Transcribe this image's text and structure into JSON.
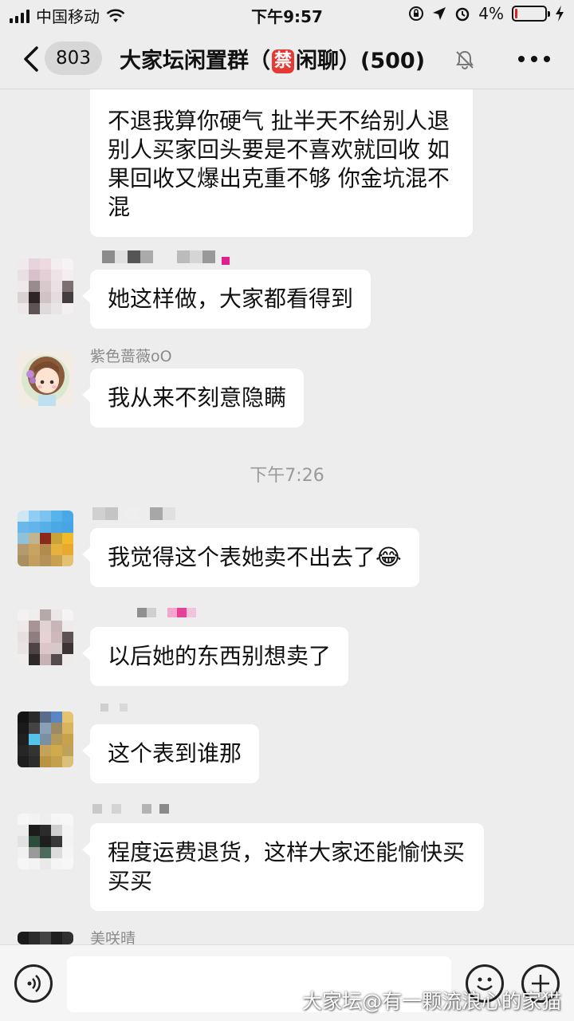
{
  "status_bar": {
    "carrier": "中国移动",
    "time": "下午9:57",
    "battery": "4%"
  },
  "nav": {
    "unread_count": "803",
    "title_prefix": "大家坛闲置群（",
    "ban_char": "禁",
    "title_suffix": "闲聊）(500)"
  },
  "messages": [
    {
      "sender": "",
      "text": "不退我算你硬气 扯半天不给别人退 别人买家回头要是不喜欢就回收 如果回收又爆出克重不够 你金坑混不混"
    },
    {
      "sender": "",
      "text": "她这样做，大家都看得到"
    },
    {
      "sender": "紫色蔷薇oO",
      "text": "我从来不刻意隐瞒"
    },
    {
      "sender": "",
      "text": "我觉得这个表她卖不出去了",
      "emoji": "😂"
    },
    {
      "sender": "",
      "text": "以后她的东西别想卖了"
    },
    {
      "sender": "",
      "text": "这个表到谁那"
    },
    {
      "sender": "",
      "text": "程度运费退货，这样大家还能愉快买买买"
    },
    {
      "sender": "美咲晴",
      "text": ""
    }
  ],
  "time_separator": "下午7:26",
  "watermark": "大家坛@有一颗流浪心的家猫",
  "colors": {
    "background": "#ededed",
    "bubble": "#ffffff",
    "ban_badge": "#e53935"
  }
}
